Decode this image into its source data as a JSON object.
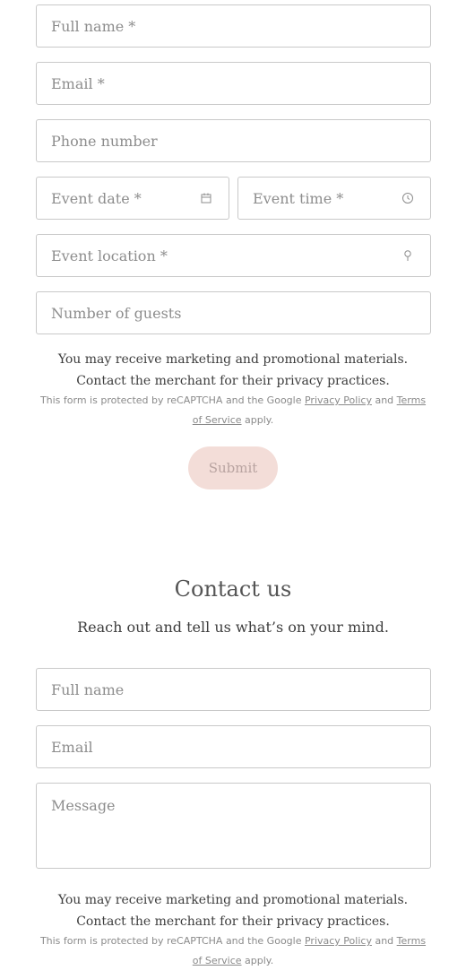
{
  "event_form": {
    "full_name_placeholder": "Full name *",
    "email_placeholder": "Email *",
    "phone_placeholder": "Phone number",
    "event_date_placeholder": "Event date *",
    "event_time_placeholder": "Event time *",
    "event_location_placeholder": "Event location *",
    "guests_placeholder": "Number of guests",
    "marketing_notice": "You may receive marketing and promotional materials. Contact the merchant for their privacy practices.",
    "recaptcha": {
      "prefix": "This form is protected by reCAPTCHA and the Google",
      "privacy_link": "Privacy Policy",
      "and": "and",
      "terms_link": "Terms of Service",
      "suffix": "apply."
    },
    "submit_label": "Submit",
    "icons": {
      "date": "calendar-icon",
      "time": "clock-icon",
      "location": "location-pin-icon"
    }
  },
  "contact_section": {
    "title": "Contact us",
    "subtitle": "Reach out and tell us what’s on your mind.",
    "full_name_placeholder": "Full name",
    "email_placeholder": "Email",
    "message_placeholder": "Message",
    "marketing_notice": "You may receive marketing and promotional materials. Contact the merchant for their privacy practices.",
    "recaptcha": {
      "prefix": "This form is protected by reCAPTCHA and the Google",
      "privacy_link": "Privacy Policy",
      "and": "and",
      "terms_link": "Terms of Service",
      "suffix": "apply."
    }
  },
  "colors": {
    "border": "#c9c9c9",
    "placeholder": "#8d8d8d",
    "submit_bg": "#f3ddd8",
    "submit_text": "#b8a3a0"
  }
}
